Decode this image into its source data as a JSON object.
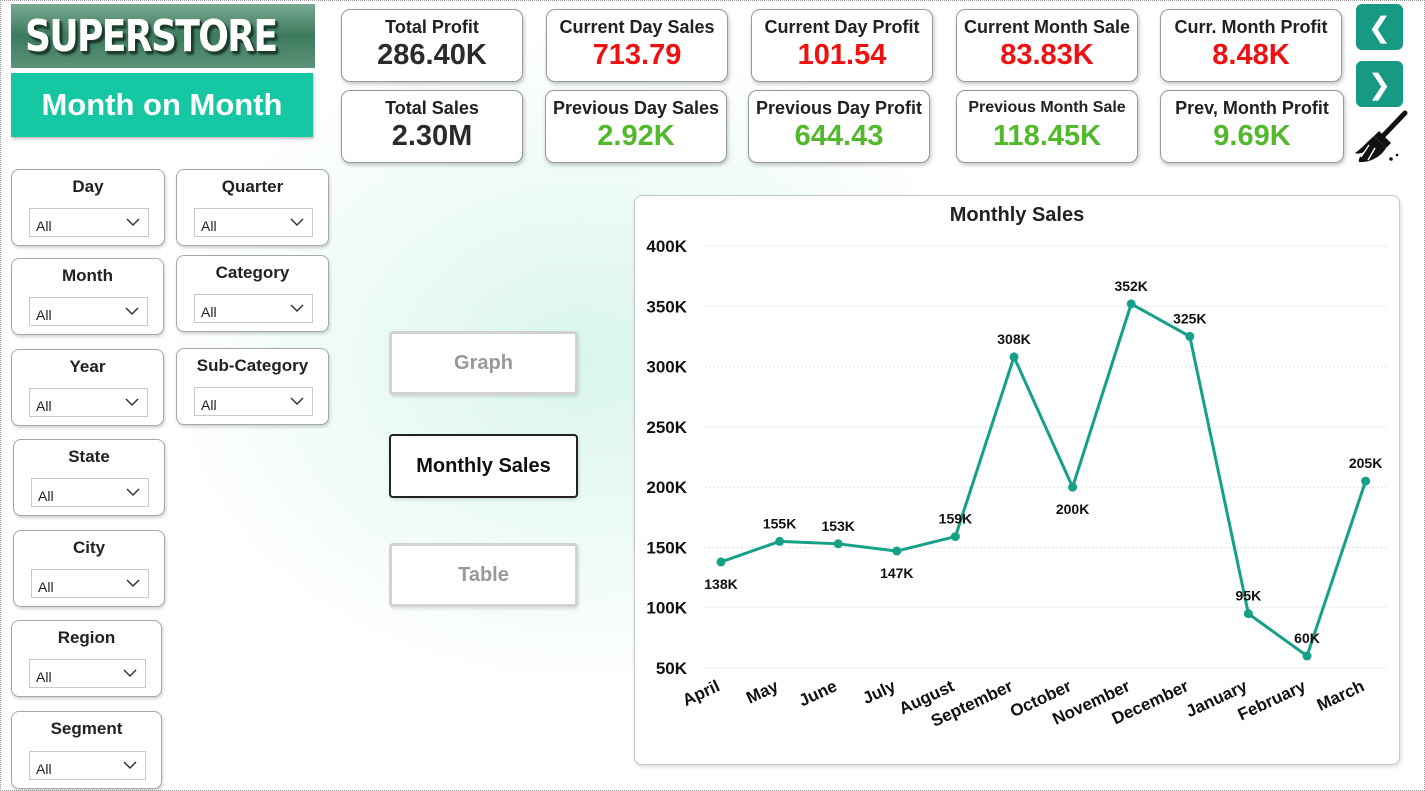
{
  "header": {
    "logo_text": "SUPERSTORE",
    "page_title": "Month on Month"
  },
  "kpis": [
    {
      "label": "Total Profit",
      "value": "286.40K",
      "color": "#2b2b2b"
    },
    {
      "label": "Current Day Sales",
      "value": "713.79",
      "color": "#f01010"
    },
    {
      "label": "Current Day Profit",
      "value": "101.54",
      "color": "#f01010"
    },
    {
      "label": "Current Month Sale",
      "value": "83.83K",
      "color": "#f01010"
    },
    {
      "label": "Curr. Month Profit",
      "value": "8.48K",
      "color": "#f01010"
    },
    {
      "label": "Total Sales",
      "value": "2.30M",
      "color": "#2b2b2b"
    },
    {
      "label": "Previous Day Sales",
      "value": "2.92K",
      "color": "#52b82c"
    },
    {
      "label": "Previous Day Profit",
      "value": "644.43",
      "color": "#52b82c"
    },
    {
      "label": "Previous Month Sale",
      "value": "118.45K",
      "color": "#52b82c"
    },
    {
      "label": "Prev, Month Profit",
      "value": "9.69K",
      "color": "#52b82c"
    }
  ],
  "nav": {
    "back_glyph": "❮",
    "next_glyph": "❯",
    "clear_icon": "broom-icon"
  },
  "filters": {
    "day": {
      "title": "Day",
      "value": "All"
    },
    "quarter": {
      "title": "Quarter",
      "value": "All"
    },
    "month": {
      "title": "Month",
      "value": "All"
    },
    "category": {
      "title": "Category",
      "value": "All"
    },
    "year": {
      "title": "Year",
      "value": "All"
    },
    "sub_category": {
      "title": "Sub-Category",
      "value": "All"
    },
    "state": {
      "title": "State",
      "value": "All"
    },
    "city": {
      "title": "City",
      "value": "All"
    },
    "region": {
      "title": "Region",
      "value": "All"
    },
    "segment": {
      "title": "Segment",
      "value": "All"
    }
  },
  "toggles": {
    "graph": "Graph",
    "monthly_sales": "Monthly Sales",
    "table": "Table",
    "active": "monthly_sales"
  },
  "chart_data": {
    "type": "line",
    "title": "Monthly Sales",
    "xlabel": "",
    "ylabel": "",
    "categories": [
      "April",
      "May",
      "June",
      "July",
      "August",
      "September",
      "October",
      "November",
      "December",
      "January",
      "February",
      "March"
    ],
    "series": [
      {
        "values": [
          138,
          155,
          153,
          147,
          159,
          308,
          200,
          352,
          325,
          95,
          60,
          205
        ],
        "color": "#15a088"
      }
    ],
    "data_labels": [
      "138K",
      "155K",
      "153K",
      "147K",
      "159K",
      "308K",
      "200K",
      "352K",
      "325K",
      "95K",
      "60K",
      "205K"
    ],
    "y_ticks": [
      "50K",
      "100K",
      "150K",
      "200K",
      "250K",
      "300K",
      "350K",
      "400K"
    ],
    "y_unit": "K",
    "ylim": [
      50,
      400
    ],
    "grid": true
  }
}
